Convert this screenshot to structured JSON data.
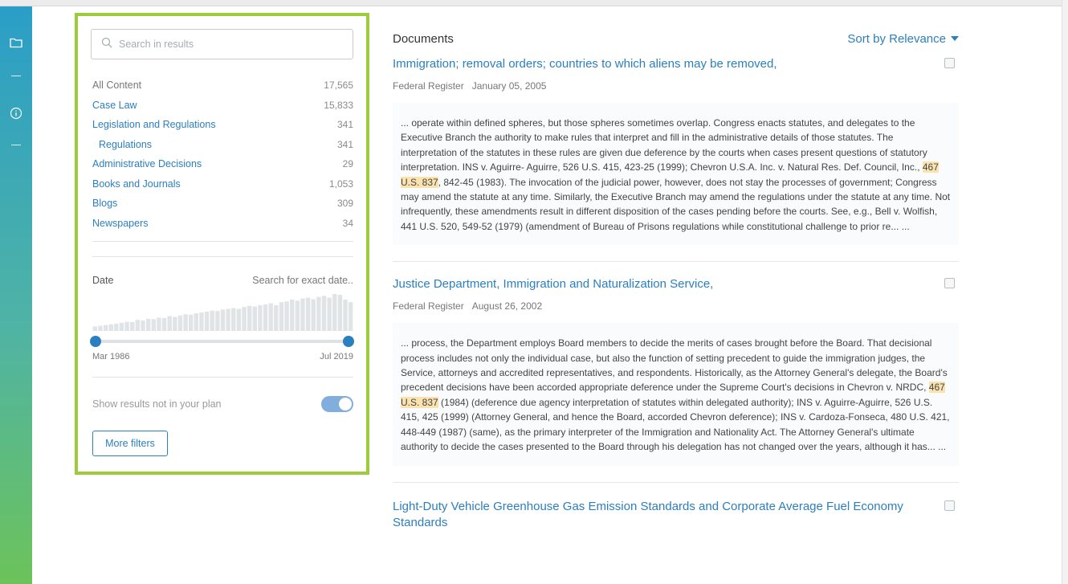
{
  "rail": {
    "icons": [
      "folder-icon",
      "info-icon"
    ]
  },
  "filters": {
    "search_placeholder": "Search in results",
    "categories": [
      {
        "label": "All Content",
        "count": "17,565",
        "kind": "all"
      },
      {
        "label": "Case Law",
        "count": "15,833",
        "kind": "link"
      },
      {
        "label": "Legislation and Regulations",
        "count": "341",
        "kind": "link"
      },
      {
        "label": "Regulations",
        "count": "341",
        "kind": "sub"
      },
      {
        "label": "Administrative Decisions",
        "count": "29",
        "kind": "link"
      },
      {
        "label": "Books and Journals",
        "count": "1,053",
        "kind": "link"
      },
      {
        "label": "Blogs",
        "count": "309",
        "kind": "link"
      },
      {
        "label": "Newspapers",
        "count": "34",
        "kind": "link"
      }
    ],
    "date_label": "Date",
    "exact_date": "Search for exact date..",
    "histogram": [
      0.12,
      0.14,
      0.16,
      0.18,
      0.2,
      0.22,
      0.25,
      0.24,
      0.3,
      0.28,
      0.33,
      0.32,
      0.36,
      0.35,
      0.4,
      0.38,
      0.42,
      0.45,
      0.44,
      0.48,
      0.5,
      0.52,
      0.55,
      0.54,
      0.58,
      0.6,
      0.62,
      0.6,
      0.65,
      0.68,
      0.66,
      0.7,
      0.72,
      0.75,
      0.7,
      0.78,
      0.8,
      0.85,
      0.82,
      0.88,
      0.9,
      0.86,
      0.92,
      0.95,
      0.9,
      1.0,
      0.98,
      0.85,
      0.78
    ],
    "range_start": "Mar 1986",
    "range_end": "Jul 2019",
    "plan_label": "Show results not in your plan",
    "plan_toggle_on": true,
    "more_filters": "More filters"
  },
  "documents": {
    "heading": "Documents",
    "sort_label": "Sort by Relevance",
    "results": [
      {
        "title": "Immigration; removal orders; countries to which aliens may be removed,",
        "source": "Federal Register",
        "date": "January 05, 2005",
        "snippet_before": "... operate within defined spheres, but those spheres sometimes overlap. Congress enacts statutes, and delegates to the Executive Branch the authority to make rules that interpret and fill in the administrative details of those statutes. The interpretation of the statutes in these rules are given due deference by the courts when cases present questions of statutory interpretation. INS v. Aguirre- Aguirre, 526 U.S. 415, 423-25 (1999); Chevron U.S.A. Inc. v. Natural Res. Def. Council, Inc., ",
        "snippet_highlight": "467 U.S. 837",
        "snippet_after": ", 842-45 (1983). The invocation of the judicial power, however, does not stay the processes of government; Congress may amend the statute at any time. Similarly, the Executive Branch may amend the regulations under the statute at any time. Not infrequently, these amendments result in different disposition of the cases pending before the courts. See, e.g., Bell v. Wolfish, 441 U.S. 520, 549-52 (1979) (amendment of Bureau of Prisons regulations while constitutional challenge to prior re... ..."
      },
      {
        "title": "Justice Department, Immigration and Naturalization Service,",
        "source": "Federal Register",
        "date": "August 26, 2002",
        "snippet_before": "... process, the Department employs Board members to decide the merits of cases brought before the Board. That decisional process includes not only the individual case, but also the function of setting precedent to guide the immigration judges, the Service, attorneys and accredited representatives, and respondents. Historically, as the Attorney General's delegate, the Board's precedent decisions have been accorded appropriate deference under the Supreme Court's decisions in Chevron v. NRDC, ",
        "snippet_highlight": "467 U.S. 837",
        "snippet_after": " (1984) (deference due agency interpretation of statutes within delegated authority); INS v. Aguirre-Aguirre, 526 U.S. 415, 425 (1999) (Attorney General, and hence the Board, accorded Chevron deference); INS v. Cardoza-Fonseca, 480 U.S. 421, 448-449 (1987) (same), as the primary interpreter of the Immigration and Nationality Act. The Attorney General's ultimate authority to decide the cases presented to the Board through his delegation has not changed over the years, although it has... ..."
      },
      {
        "title": "Light-Duty Vehicle Greenhouse Gas Emission Standards and Corporate Average Fuel Economy Standards"
      }
    ]
  },
  "colors": {
    "accent": "#2b7fbf",
    "filter_border": "#9ccc3c",
    "highlight": "#fbe3b0"
  }
}
